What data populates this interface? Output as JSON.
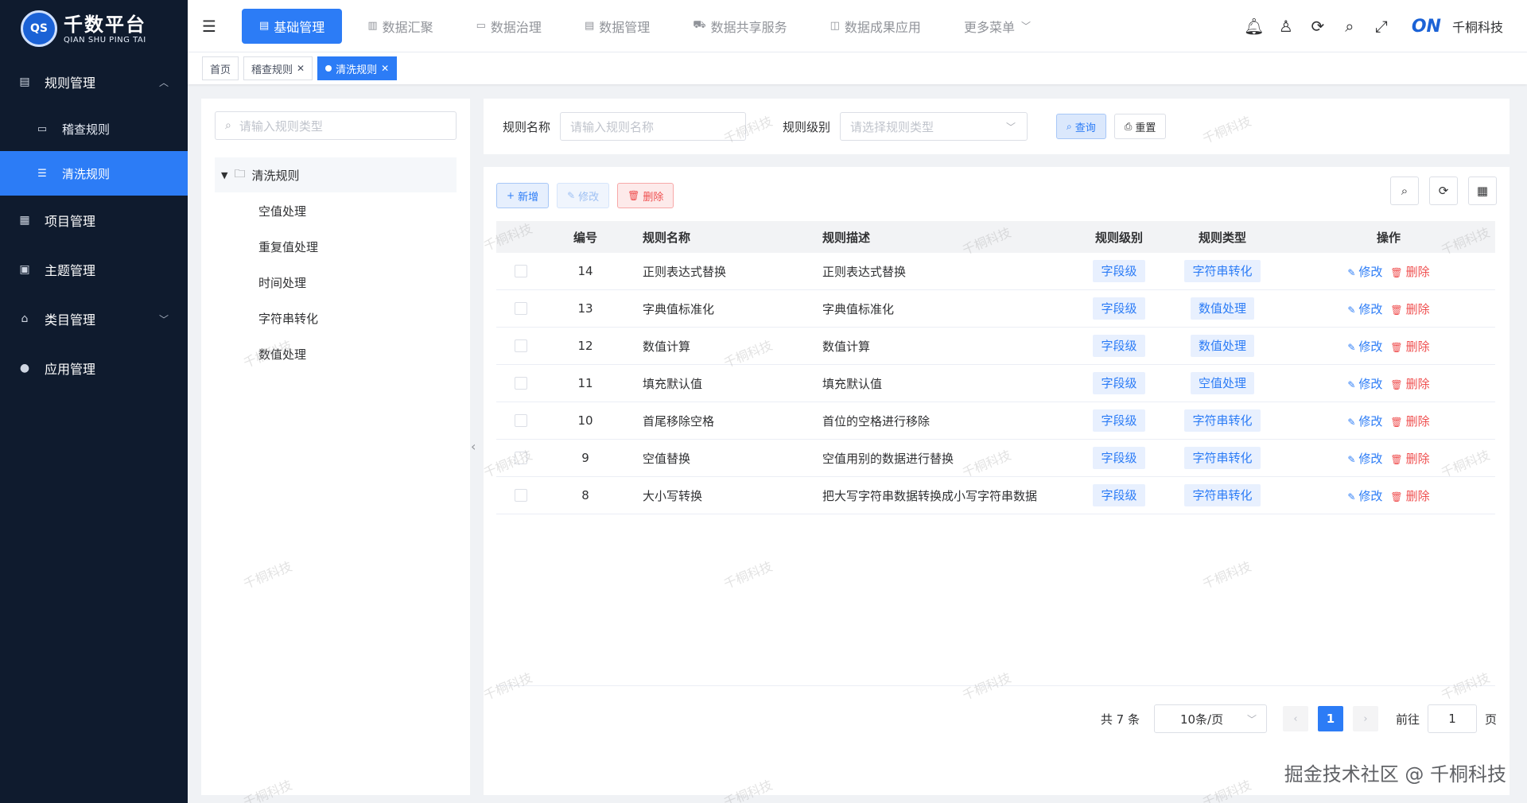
{
  "app": {
    "logo_badge": "QS",
    "title": "千数平台",
    "subtitle": "QIAN SHU PING TAI"
  },
  "sidebar": {
    "items": [
      {
        "label": "规则管理",
        "icon": "book-icon",
        "expanded": true
      },
      {
        "label": "稽查规则",
        "icon": "monitor-icon",
        "sub": true
      },
      {
        "label": "清洗规则",
        "icon": "list-icon",
        "sub": true,
        "active": true
      },
      {
        "label": "项目管理",
        "icon": "grid-icon"
      },
      {
        "label": "主题管理",
        "icon": "card-icon"
      },
      {
        "label": "类目管理",
        "icon": "tag-icon",
        "chevron": "down"
      },
      {
        "label": "应用管理",
        "icon": "github-icon"
      }
    ]
  },
  "topnav": {
    "items": [
      {
        "label": "基础管理",
        "active": true
      },
      {
        "label": "数据汇聚"
      },
      {
        "label": "数据治理"
      },
      {
        "label": "数据管理"
      },
      {
        "label": "数据共享服务"
      },
      {
        "label": "数据成果应用"
      },
      {
        "label": "更多菜单"
      }
    ],
    "brand": "千桐科技"
  },
  "tabs": [
    {
      "label": "首页"
    },
    {
      "label": "稽查规则",
      "closable": true
    },
    {
      "label": "清洗规则",
      "closable": true,
      "active": true
    }
  ],
  "tree": {
    "search_placeholder": "请输入规则类型",
    "root": "清洗规则",
    "children": [
      "空值处理",
      "重复值处理",
      "时间处理",
      "字符串转化",
      "数值处理"
    ]
  },
  "search": {
    "name_label": "规则名称",
    "name_placeholder": "请输入规则名称",
    "level_label": "规则级别",
    "level_placeholder": "请选择规则类型",
    "query_label": "查询",
    "reset_label": "重置"
  },
  "toolbar": {
    "add_label": "新增",
    "edit_label": "修改",
    "delete_label": "删除"
  },
  "table": {
    "columns": [
      "编号",
      "规则名称",
      "规则描述",
      "规则级别",
      "规则类型",
      "操作"
    ],
    "op_edit": "修改",
    "op_delete": "删除",
    "rows": [
      {
        "id": "14",
        "name": "正则表达式替换",
        "desc": "正则表达式替换",
        "level": "字段级",
        "type": "字符串转化"
      },
      {
        "id": "13",
        "name": "字典值标准化",
        "desc": "字典值标准化",
        "level": "字段级",
        "type": "数值处理"
      },
      {
        "id": "12",
        "name": "数值计算",
        "desc": "数值计算",
        "level": "字段级",
        "type": "数值处理"
      },
      {
        "id": "11",
        "name": "填充默认值",
        "desc": "填充默认值",
        "level": "字段级",
        "type": "空值处理"
      },
      {
        "id": "10",
        "name": "首尾移除空格",
        "desc": "首位的空格进行移除",
        "level": "字段级",
        "type": "字符串转化"
      },
      {
        "id": "9",
        "name": "空值替换",
        "desc": "空值用别的数据进行替换",
        "level": "字段级",
        "type": "字符串转化"
      },
      {
        "id": "8",
        "name": "大小写转换",
        "desc": "把大写字符串数据转换成小写字符串数据",
        "level": "字段级",
        "type": "字符串转化"
      }
    ]
  },
  "pager": {
    "total": "共 7 条",
    "page_size": "10条/页",
    "current": "1",
    "goto_label": "前往",
    "goto_value": "1",
    "page_unit": "页"
  },
  "watermark": "千桐科技",
  "credit": "掘金技术社区 @ 千桐科技",
  "colors": {
    "primary": "#2c7cf6",
    "sidebar_bg": "#0f1b2e",
    "danger": "#ef4f4f"
  }
}
